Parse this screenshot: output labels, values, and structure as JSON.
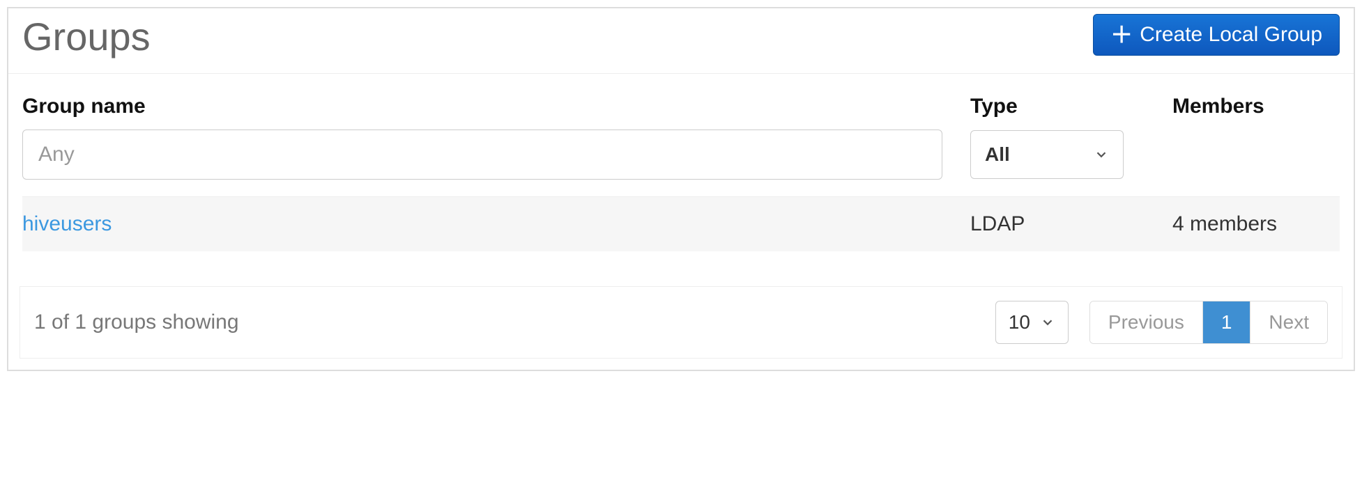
{
  "header": {
    "title": "Groups",
    "create_label": "Create Local Group"
  },
  "table": {
    "columns": {
      "name": "Group name",
      "type": "Type",
      "members": "Members"
    },
    "filters": {
      "name_placeholder": "Any",
      "type_selected": "All"
    },
    "rows": [
      {
        "name": "hiveusers",
        "type": "LDAP",
        "members": "4 members"
      }
    ]
  },
  "footer": {
    "status": "1 of 1 groups showing",
    "per_page": "10",
    "pager": {
      "prev": "Previous",
      "current": "1",
      "next": "Next"
    }
  }
}
